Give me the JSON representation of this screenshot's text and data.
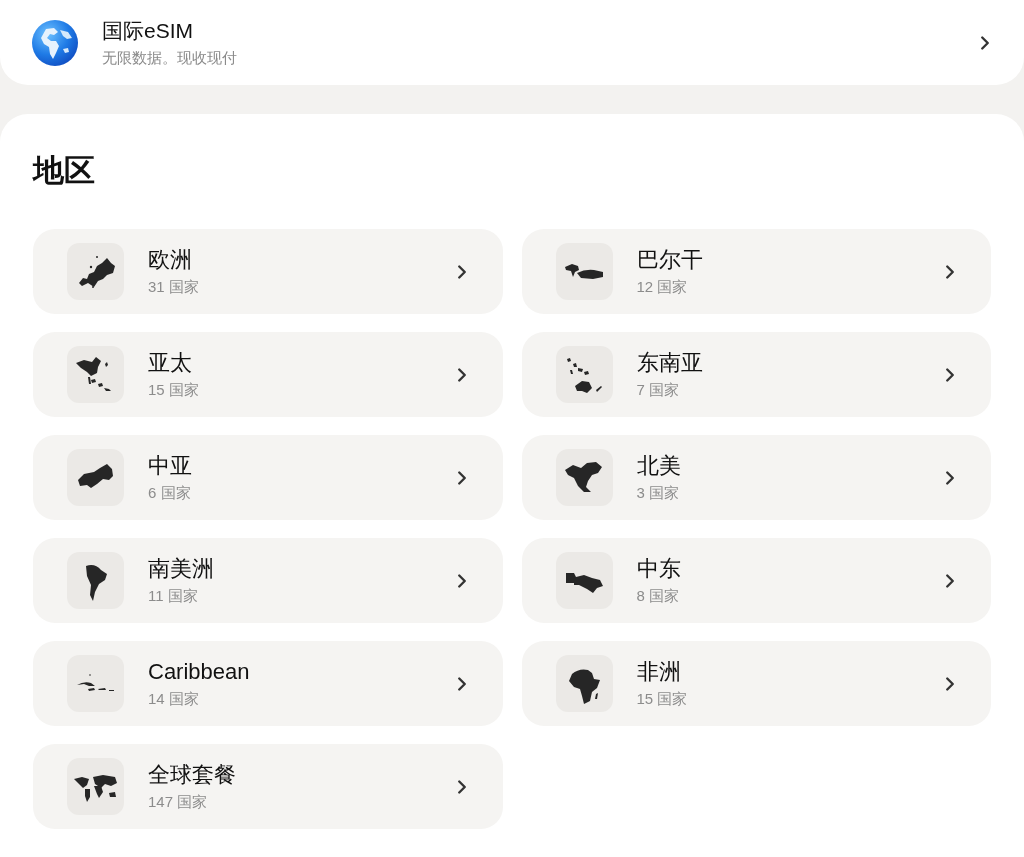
{
  "banner": {
    "title": "国际eSIM",
    "subtitle": "无限数据。现收现付"
  },
  "regions": {
    "heading": "地区",
    "items": [
      {
        "name": "欧洲",
        "count": "31 国家"
      },
      {
        "name": "巴尔干",
        "count": "12 国家"
      },
      {
        "name": "亚太",
        "count": "15 国家"
      },
      {
        "name": "东南亚",
        "count": "7 国家"
      },
      {
        "name": "中亚",
        "count": "6 国家"
      },
      {
        "name": "北美",
        "count": "3 国家"
      },
      {
        "name": "南美洲",
        "count": "11 国家"
      },
      {
        "name": "中东",
        "count": "8 国家"
      },
      {
        "name": "Caribbean",
        "count": "14 国家"
      },
      {
        "name": "非洲",
        "count": "15 国家"
      },
      {
        "name": "全球套餐",
        "count": "147 国家"
      }
    ]
  }
}
